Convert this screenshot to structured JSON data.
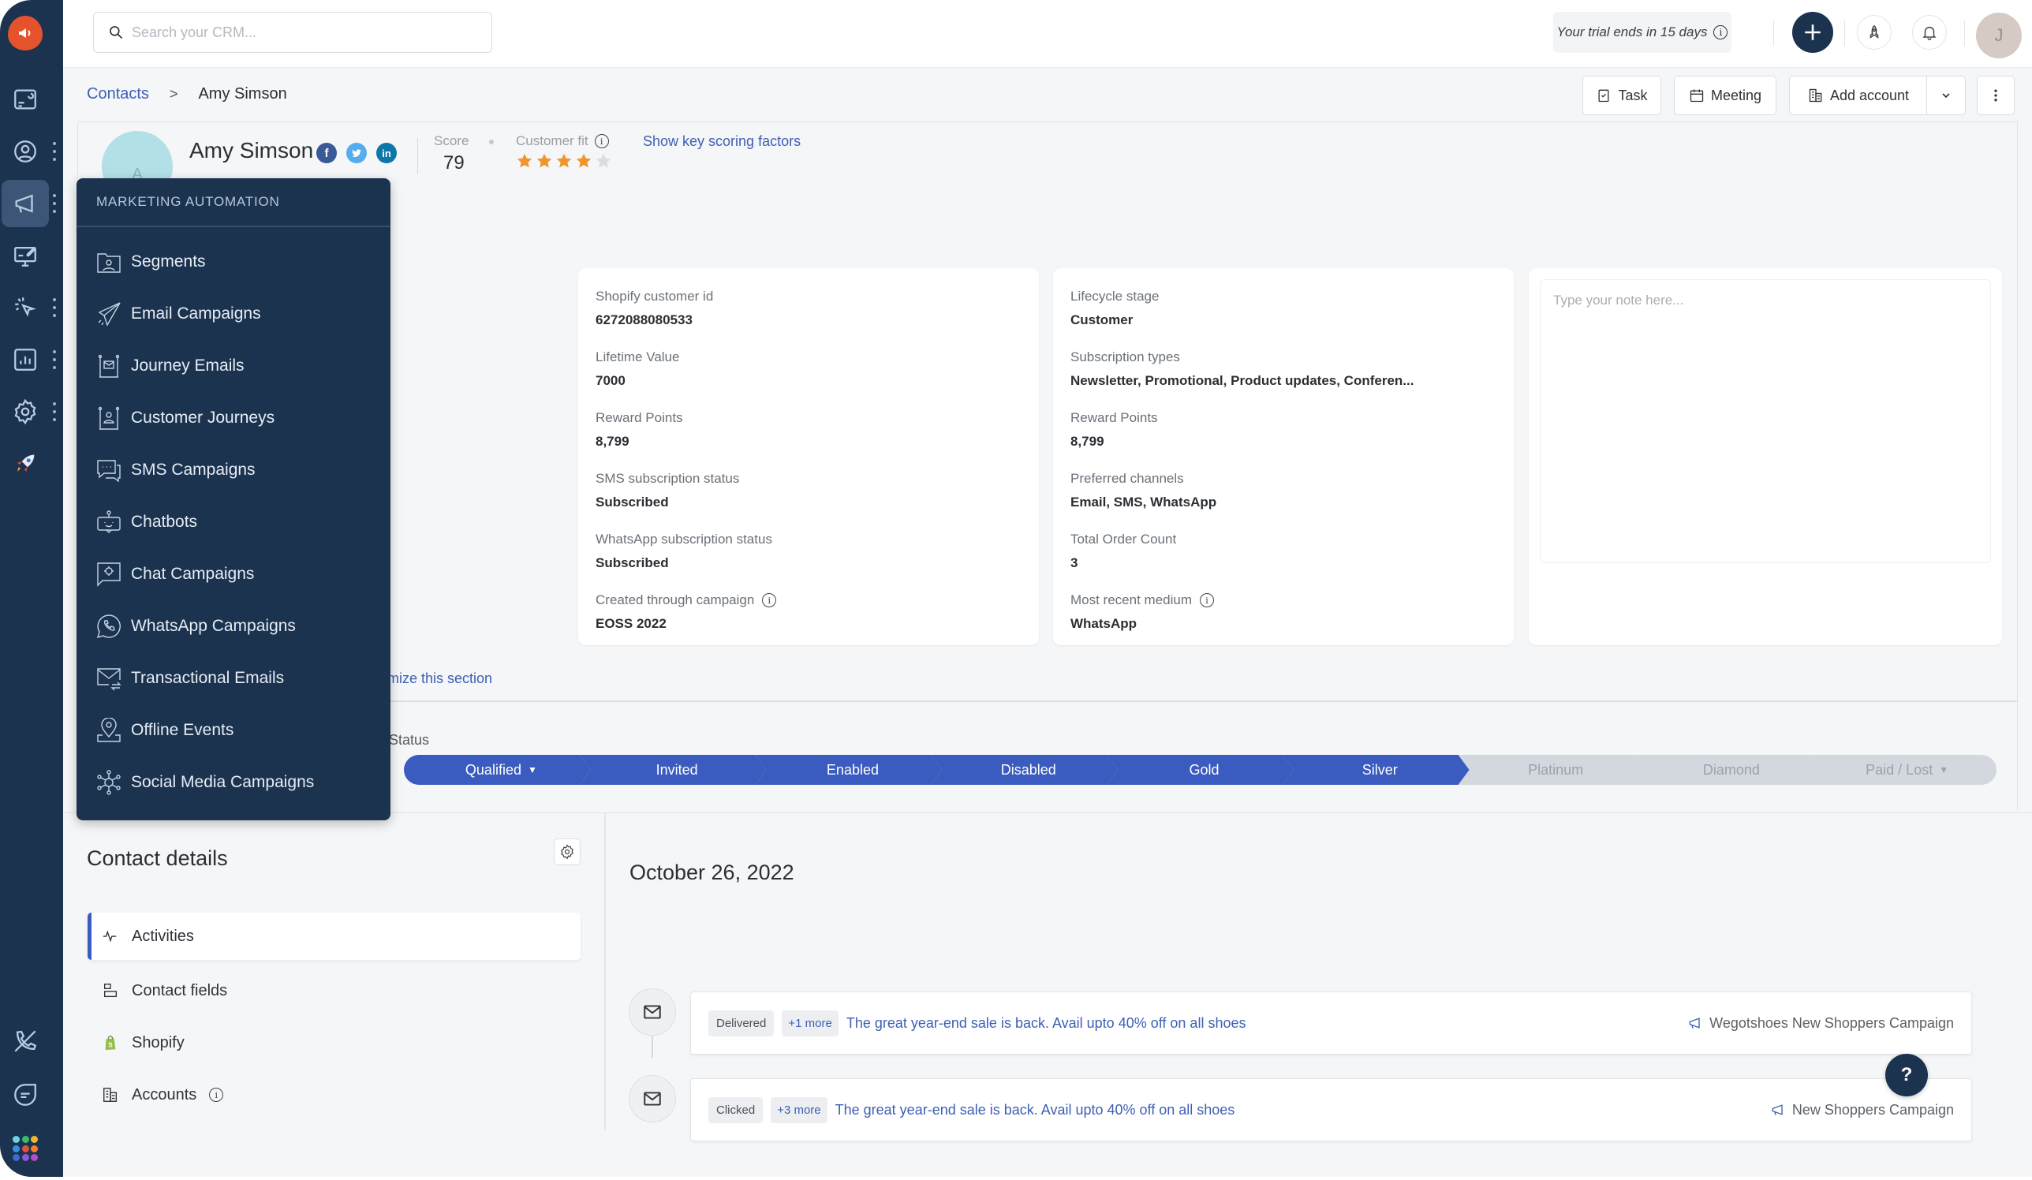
{
  "app": {
    "rail": {
      "logo": "megaphone-logo",
      "items": [
        {
          "name": "dashboard",
          "icon": "dashboard-icon",
          "has_menu": false
        },
        {
          "name": "contacts",
          "icon": "contact-icon",
          "has_menu": true
        },
        {
          "name": "marketing",
          "icon": "megaphone-icon",
          "has_menu": true,
          "active": true
        },
        {
          "name": "web",
          "icon": "monitor-edit-icon",
          "has_menu": false
        },
        {
          "name": "tracking",
          "icon": "cursor-click-icon",
          "has_menu": true
        },
        {
          "name": "reports",
          "icon": "bar-chart-icon",
          "has_menu": true
        },
        {
          "name": "settings",
          "icon": "gear-icon",
          "has_menu": true
        },
        {
          "name": "getting-started",
          "icon": "rocket-icon",
          "has_menu": false
        }
      ],
      "bottom": [
        "phone-off-icon",
        "chat-bubble-icon",
        "apps-grid-icon"
      ],
      "apps_grid_colors": [
        "#6fd3e3",
        "#3cba6b",
        "#f2b531",
        "#3a8fe0",
        "#e0533b",
        "#f0822f",
        "#3d6bd0",
        "#8b59d6",
        "#b24fc5"
      ]
    },
    "topbar": {
      "search_placeholder": "Search your CRM...",
      "trial_text": "Your trial ends in 15 days",
      "user_initial": "J"
    }
  },
  "breadcrumb": {
    "parent": "Contacts",
    "separator": ">",
    "current": "Amy Simson"
  },
  "actions": {
    "task": "Task",
    "meeting": "Meeting",
    "add_account": "Add account"
  },
  "contact": {
    "initial": "A",
    "name": "Amy Simson",
    "social": [
      {
        "name": "facebook",
        "glyph": "f",
        "color": "#3b5998"
      },
      {
        "name": "twitter",
        "glyph": "t",
        "color": "#55acee"
      },
      {
        "name": "linkedin",
        "glyph": "in",
        "color": "#0e76a8"
      }
    ],
    "score_label": "Score",
    "score": "79",
    "fit_label": "Customer fit",
    "fit_stars": 4,
    "fit_max": 5,
    "key_factors_link": "Show key scoring factors"
  },
  "cards": {
    "shopify": [
      {
        "label": "Shopify customer id",
        "value": "6272088080533"
      },
      {
        "label": "Lifetime Value",
        "value": "7000"
      },
      {
        "label": "Reward Points",
        "value": "8,799"
      },
      {
        "label": "SMS subscription status",
        "value": "Subscribed"
      },
      {
        "label": "WhatsApp subscription status",
        "value": "Subscribed"
      },
      {
        "label": "Created through campaign",
        "value": "EOSS 2022",
        "info": true
      }
    ],
    "lifecycle": [
      {
        "label": "Lifecycle stage",
        "value": "Customer"
      },
      {
        "label": "Subscription types",
        "value": "Newsletter, Promotional, Product updates, Conferen..."
      },
      {
        "label": "Reward Points",
        "value": "8,799"
      },
      {
        "label": "Preferred channels",
        "value": "Email, SMS, WhatsApp"
      },
      {
        "label": "Total Order Count",
        "value": "3"
      },
      {
        "label": "Most recent medium",
        "value": "WhatsApp",
        "info": true
      }
    ],
    "note_placeholder": "Type your note here..."
  },
  "customize_link": "mize this section",
  "status": {
    "label": "Status",
    "stages": [
      {
        "label": "Qualified",
        "done": true,
        "dropdown": true
      },
      {
        "label": "Invited",
        "done": true
      },
      {
        "label": "Enabled",
        "done": true
      },
      {
        "label": "Disabled",
        "done": true
      },
      {
        "label": "Gold",
        "done": true
      },
      {
        "label": "Silver",
        "done": true
      },
      {
        "label": "Platinum",
        "done": false
      },
      {
        "label": "Diamond",
        "done": false
      },
      {
        "label": "Paid / Lost",
        "done": false,
        "dropdown": true
      }
    ],
    "colors": {
      "done": "#3a5bbf",
      "todo": "#d3d8de"
    }
  },
  "details": {
    "title": "Contact details",
    "nav": [
      {
        "label": "Activities",
        "icon": "activity-icon",
        "active": true
      },
      {
        "label": "Contact fields",
        "icon": "fields-icon"
      },
      {
        "label": "Shopify",
        "icon": "shopify-icon"
      },
      {
        "label": "Accounts",
        "icon": "building-icon",
        "info": true
      }
    ]
  },
  "timeline": {
    "date": "October 26, 2022",
    "items": [
      {
        "badge": "Delivered",
        "more": "+1 more",
        "subject": "The great year-end sale is back. Avail upto 40% off on all shoes",
        "campaign": "Wegotshoes New Shoppers Campaign"
      },
      {
        "badge": "Clicked",
        "more": "+3 more",
        "subject": "The great year-end sale is back. Avail upto 40% off on all shoes",
        "campaign": "New Shoppers Campaign"
      }
    ]
  },
  "flyout": {
    "title": "MARKETING AUTOMATION",
    "items": [
      {
        "label": "Segments",
        "icon": "segments-icon"
      },
      {
        "label": "Email Campaigns",
        "icon": "paper-plane-icon"
      },
      {
        "label": "Journey Emails",
        "icon": "journey-email-icon"
      },
      {
        "label": "Customer Journeys",
        "icon": "customer-journey-icon"
      },
      {
        "label": "SMS Campaigns",
        "icon": "sms-icon"
      },
      {
        "label": "Chatbots",
        "icon": "chatbot-icon"
      },
      {
        "label": "Chat Campaigns",
        "icon": "chat-campaign-icon"
      },
      {
        "label": "WhatsApp Campaigns",
        "icon": "whatsapp-icon"
      },
      {
        "label": "Transactional Emails",
        "icon": "transactional-email-icon"
      },
      {
        "label": "Offline Events",
        "icon": "location-pin-icon"
      },
      {
        "label": "Social Media Campaigns",
        "icon": "social-network-icon"
      }
    ]
  },
  "help_label": "?"
}
